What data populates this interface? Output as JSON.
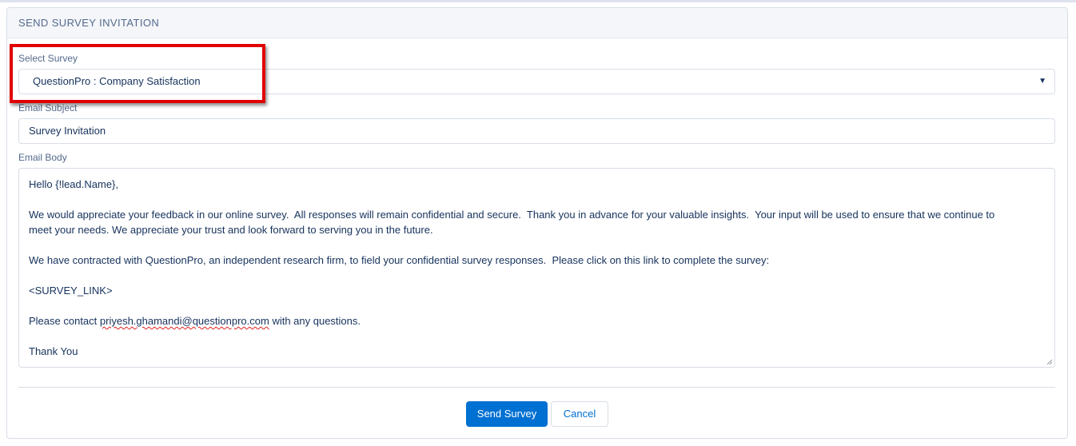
{
  "header": {
    "title": "SEND SURVEY INVITATION"
  },
  "select_survey": {
    "label": "Select Survey",
    "value": "QuestionPro : Company Satisfaction",
    "arrow": "▼"
  },
  "email_subject": {
    "label": "Email Subject",
    "value": "Survey Invitation"
  },
  "email_body": {
    "label": "Email Body",
    "line1": "Hello {!lead.Name},",
    "line2": "We would appreciate your feedback in our online survey.  All responses will remain confidential and secure.  Thank you in advance for your valuable insights.  Your input will be used to ensure that we continue to",
    "line3": "meet your needs. We appreciate your trust and look forward to serving you in the future.",
    "line4": "We have contracted with QuestionPro, an independent research firm, to field your confidential survey responses.  Please click on this link to complete the survey:",
    "line5": "<SURVEY_LINK>",
    "contact_prefix": "Please contact ",
    "contact_email": "priyesh.ghamandi@questionpro.com",
    "contact_suffix": " with any questions.",
    "line7": "Thank You"
  },
  "actions": {
    "send_label": "Send Survey",
    "cancel_label": "Cancel"
  },
  "colors": {
    "primary": "#0070d2",
    "highlight": "#e00000",
    "header_bg": "#f4f6f9"
  },
  "icons": {
    "select_arrow": "chevron-down-icon",
    "resize": "resize-grip-icon"
  }
}
